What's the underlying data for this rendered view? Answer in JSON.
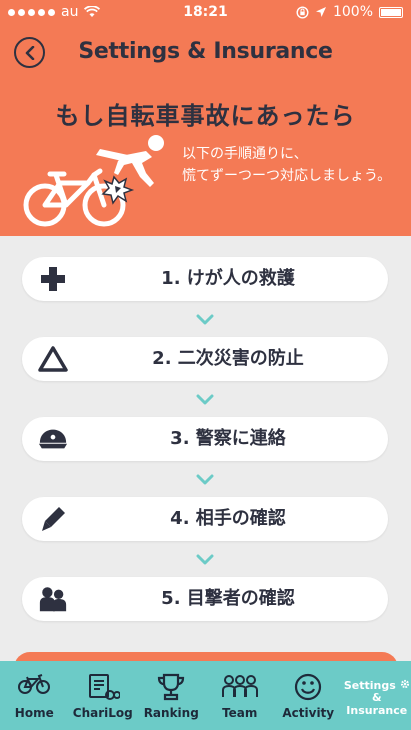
{
  "status_bar": {
    "carrier": "au",
    "time": "18:21",
    "battery": "100%"
  },
  "header": {
    "title": "Settings & Insurance",
    "headline": "もし自転車事故にあったら",
    "subtext_line1": "以下の手順通りに、",
    "subtext_line2": "慌てずーつーつ対応しましょう。"
  },
  "steps": [
    {
      "label": "1. けが人の救護",
      "icon": "plus-icon"
    },
    {
      "label": "2. 二次災害の防止",
      "icon": "warning-triangle-icon"
    },
    {
      "label": "3. 警察に連絡",
      "icon": "police-cap-icon"
    },
    {
      "label": "4. 相手の確認",
      "icon": "pen-icon"
    },
    {
      "label": "5. 目撃者の確認",
      "icon": "people-icon"
    }
  ],
  "tabs": [
    {
      "label": "Home",
      "icon": "bicycle-icon"
    },
    {
      "label": "ChariLog",
      "icon": "notebook-bike-icon"
    },
    {
      "label": "Ranking",
      "icon": "trophy-icon"
    },
    {
      "label": "Team",
      "icon": "team-icon"
    },
    {
      "label": "Activity",
      "icon": "smiley-icon"
    },
    {
      "label_line1": "Settings",
      "label_line2": "&",
      "label_line3": "Insurance",
      "icon": "gear-icon"
    }
  ],
  "colors": {
    "accent": "#f47a55",
    "tabbar": "#6ccbc7",
    "text_dark": "#2e3140",
    "chevron": "#6ccbc7"
  }
}
